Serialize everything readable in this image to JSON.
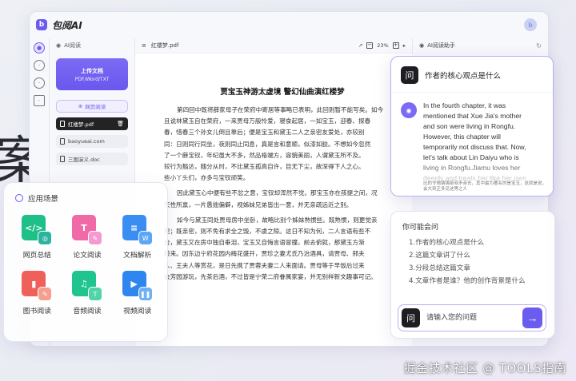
{
  "app": {
    "name": "包阅AI",
    "avatar_letter": "b"
  },
  "background_char": "案",
  "sidebar": {
    "header": "AI阅读",
    "upload": {
      "label": "上传文档",
      "formats": "PDF/Word/TXT"
    },
    "web_read": "网页阅读",
    "files": [
      {
        "name": "红楼梦.pdf",
        "active": true
      },
      {
        "name": "baoyueai.com",
        "active": false
      },
      {
        "name": "三国演义.doc",
        "active": false
      }
    ]
  },
  "document": {
    "file_label": "红楼梦.pdf",
    "zoom": "23%",
    "title": "贾宝玉神游太虚境 警幻仙曲演红楼梦",
    "paragraphs": [
      [
        "第四回中既将薛家母子在荣府中寄居等事略已表明，此回则暂不能写矣。如今",
        "且说林黛玉自在荣府，一来贾母万般怜爱，寝食起居，一如宝玉，迎春、探春",
        "春，惜春三个孙女儿倒且靠后；便是宝玉和黛玉二人之亲密友爱处，亦较别",
        "同：日则同行同坐，夜则同止同息，真是言和意顺，似漆如胶。不想如今忽然",
        "了一个薛宝钗，年纪虽大不多，然品格端方，容貌美丽，人谓黛玉所不及。",
        "较行为豁达，随分从时，不比黛玉孤高自许，目无下尘，故深得下人之心。",
        "些小丫头们，亦多与宝钗顽笑。"
      ],
      [
        "因此黛玉心中便有些不忿之意，宝钗却浑然不觉。那宝玉亦在孩提之间，况",
        "天性所禀，一片愚拙偏僻，视姊妹兄弟皆出一意，并无亲疏远近之别。"
      ],
      [
        "如今与黛玉同处贾母房中坐卧，故略比别个姊妹熟惯些。既熟惯，则更觉亲",
        "密；既亲密，则不免有求全之毁，不虞之隙。这日不知为何，二人言语有些不",
        "合，黛玉又在房中独自垂泪，宝玉又自悔言语冒撞，前去俯就，那黛玉方渐",
        "转来。因东边宁府花园内梅花盛开，贾珍之妻尤氏乃治酒具，请贾母、邢夫",
        "人、王夫人等赏花，是日先携了贾蓉夫妻二人来面请。贾母等于早饭后过来",
        "会芳园游玩，先茶后酒，不过皆是宁荣二府眷属家宴，并无别样新文趣事可记。"
      ]
    ]
  },
  "ai_panel": {
    "header": "AI阅读助手",
    "question": "作者的核心观点是什么",
    "question_avatar": "问",
    "answer": "In the fourth chapter, it was\nmentioned that Xue Jia's mother\nand son were living in Rongfu.\nHowever, this chapter will\ntemporarily not discuss that. Now,\nlet's talk about Lin Daiyu who is\nliving in Rongfu.Jiamu loves her\ndeeply and treats her like her own\ngranddaughter. Baoyu, Yingchun,",
    "answer_tail": "比的令她铸铸部叔矛亲去，其中最为著名的是宝玉，这就是说，会大到正多见这等之人"
  },
  "questions_card": {
    "title": "你可能会问",
    "items": [
      "1.作者的核心观点是什么",
      "2.这篇文章讲了什么",
      "3.分段总结这篇文章",
      "4.文章作者是谁？他的创作背景是什么"
    ],
    "input_placeholder": "请输入您的问题",
    "input_avatar": "问"
  },
  "scenarios": {
    "title": "应用场景",
    "items": [
      {
        "label": "网页总结",
        "icon": "web-summary-icon",
        "big": "</>",
        "small": "◎",
        "color": "#1fbf88",
        "small_color": "#2bb3a0"
      },
      {
        "label": "论文阅读",
        "icon": "paper-reading-icon",
        "big": "T",
        "small": "✎",
        "color": "#f06aa8",
        "small_color": "#f59ad0"
      },
      {
        "label": "文档解析",
        "icon": "doc-parse-icon",
        "big": "≡",
        "small": "W",
        "color": "#3a8ef2",
        "small_color": "#5aa6f7"
      },
      {
        "label": "图书阅读",
        "icon": "book-reading-icon",
        "big": "▮",
        "small": "✎",
        "color": "#f0605a",
        "small_color": "#f3a08f"
      },
      {
        "label": "音频阅读",
        "icon": "audio-reading-icon",
        "big": "♫",
        "small": "T",
        "color": "#1fc48e",
        "small_color": "#52d3a8"
      },
      {
        "label": "视频阅读",
        "icon": "video-reading-icon",
        "big": "▶",
        "small": "❚❚",
        "color": "#2f86ee",
        "small_color": "#6fb0f6"
      }
    ]
  },
  "watermark": "掘金技术社区 @ TOOLS指南"
}
